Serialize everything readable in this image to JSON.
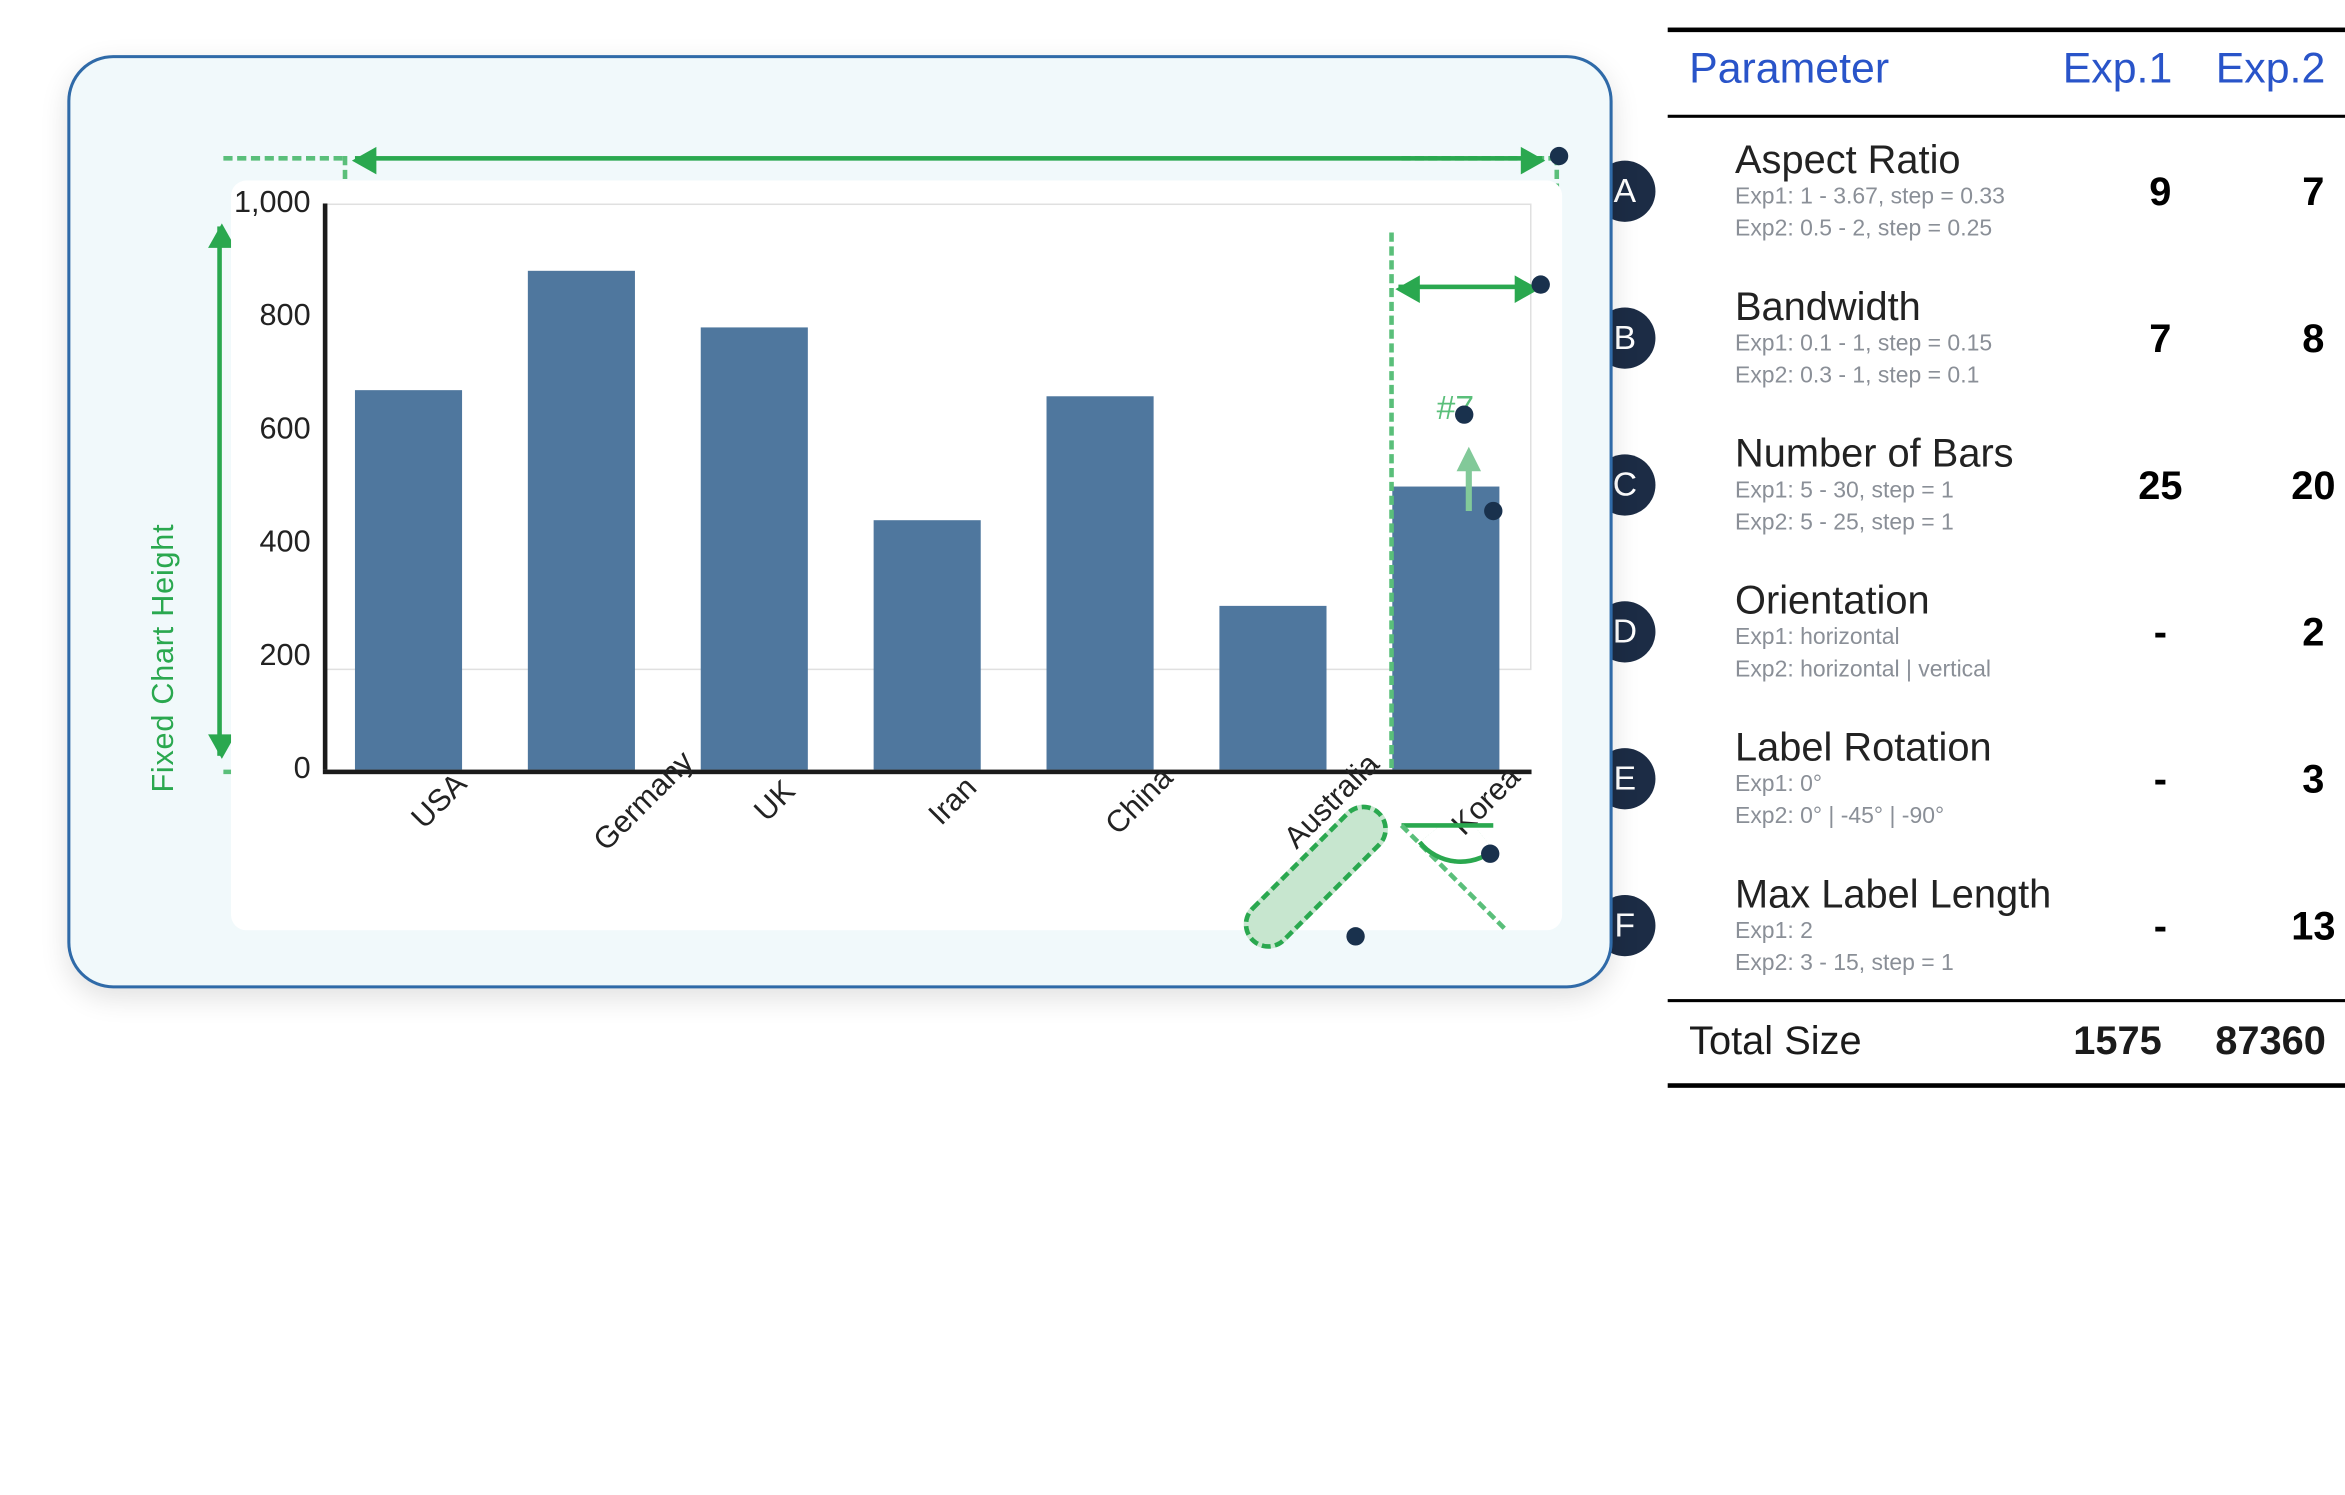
{
  "side_label": "Fixed Chart Height",
  "hash7": "#7",
  "chart_data": {
    "type": "bar",
    "categories": [
      "USA",
      "Germany",
      "UK",
      "Iran",
      "China",
      "Australia",
      "Korea"
    ],
    "values": [
      670,
      880,
      780,
      440,
      660,
      290,
      500
    ],
    "ylim": [
      0,
      1000
    ],
    "yticks": [
      0,
      200,
      400,
      600,
      800,
      1000
    ],
    "ytick_labels": [
      "0",
      "200",
      "400",
      "600",
      "800",
      "1,000"
    ],
    "xlabel": "",
    "ylabel": "",
    "title": ""
  },
  "parameter_table": {
    "columns": [
      "Parameter",
      "Exp.1",
      "Exp.2"
    ],
    "rows": [
      {
        "badge": "A",
        "name": "Aspect Ratio",
        "sub1": "Exp1:  1 - 3.67, step =  0.33",
        "sub2": "Exp2:  0.5 - 2, step = 0.25",
        "exp1": "9",
        "exp2": "7"
      },
      {
        "badge": "B",
        "name": "Bandwidth",
        "sub1": "Exp1:  0.1 - 1, step = 0.15",
        "sub2": "Exp2:  0.3 - 1, step = 0.1",
        "exp1": "7",
        "exp2": "8"
      },
      {
        "badge": "C",
        "name": "Number of Bars",
        "sub1": "Exp1:  5 - 30, step = 1",
        "sub2": "Exp2:  5 - 25, step = 1",
        "exp1": "25",
        "exp2": "20"
      },
      {
        "badge": "D",
        "name": "Orientation",
        "sub1": "Exp1: horizontal",
        "sub2": "Exp2: horizontal  |  vertical",
        "exp1": "-",
        "exp2": "2"
      },
      {
        "badge": "E",
        "name": "Label Rotation",
        "sub1": "Exp1: 0°",
        "sub2": "Exp2: 0° |  -45° |  -90°",
        "exp1": "-",
        "exp2": "3"
      },
      {
        "badge": "F",
        "name": "Max Label Length",
        "sub1": "Exp1: 2",
        "sub2": "Exp2: 3 - 15, step = 1",
        "exp1": "-",
        "exp2": "13"
      }
    ],
    "footer": {
      "label": "Total Size",
      "exp1": "1575",
      "exp2": "87360"
    }
  }
}
